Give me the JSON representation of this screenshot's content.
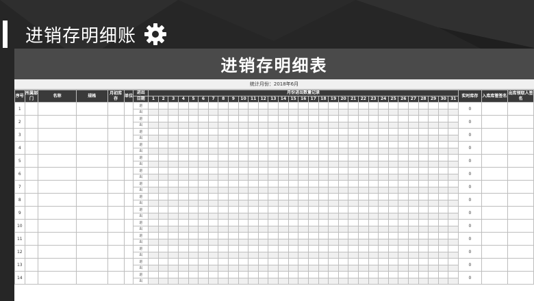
{
  "page": {
    "title": "进销存明细账"
  },
  "sheet": {
    "title": "进销存明细表",
    "subtitle": "统计月份：2018年6月",
    "headers": {
      "index": "序号",
      "dept": "所属部门",
      "name": "名称",
      "spec": "规格",
      "opening": "月初库存",
      "unit": "单位",
      "io": "进出",
      "date": "日期",
      "monthly": "月份进出数量记录",
      "actual": "实时库存",
      "in_sign": "入库库管签名",
      "out_sign": "出库领取人签名"
    },
    "days": [
      "1",
      "2",
      "3",
      "4",
      "5",
      "6",
      "7",
      "8",
      "9",
      "10",
      "11",
      "12",
      "13",
      "14",
      "15",
      "16",
      "17",
      "18",
      "19",
      "20",
      "21",
      "22",
      "23",
      "24",
      "25",
      "26",
      "27",
      "28",
      "29",
      "30",
      "31"
    ],
    "io_in": "进",
    "io_out": "出",
    "rows": [
      {
        "no": "1",
        "stock": "0"
      },
      {
        "no": "2",
        "stock": "0"
      },
      {
        "no": "3",
        "stock": "0"
      },
      {
        "no": "4",
        "stock": "0"
      },
      {
        "no": "5",
        "stock": "0"
      },
      {
        "no": "6",
        "stock": "0"
      },
      {
        "no": "7",
        "stock": "0"
      },
      {
        "no": "8",
        "stock": "0"
      },
      {
        "no": "9",
        "stock": "0"
      },
      {
        "no": "10",
        "stock": "0"
      },
      {
        "no": "11",
        "stock": "0"
      },
      {
        "no": "12",
        "stock": "0"
      },
      {
        "no": "13",
        "stock": "0"
      },
      {
        "no": "14",
        "stock": "0"
      }
    ]
  },
  "icons": {
    "settings": "gear-icon"
  },
  "colors": {
    "background": "#262626",
    "banner": "#4a4a4a",
    "header": "#3a3a3a",
    "text_on_dark": "#ffffff"
  }
}
